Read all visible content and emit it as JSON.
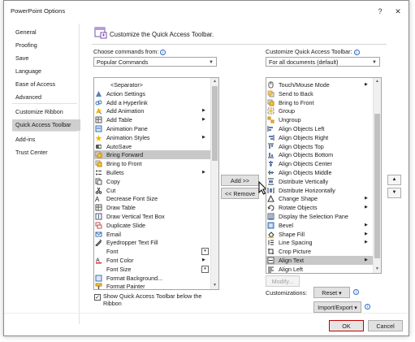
{
  "window": {
    "title": "PowerPoint Options",
    "help_label": "?",
    "close_label": "✕"
  },
  "nav": {
    "items": [
      {
        "label": "General"
      },
      {
        "label": "Proofing"
      },
      {
        "label": "Save"
      },
      {
        "label": "Language"
      },
      {
        "label": "Ease of Access"
      },
      {
        "label": "Advanced"
      },
      {
        "label": "Customize Ribbon"
      },
      {
        "label": "Quick Access Toolbar",
        "selected": true
      },
      {
        "label": "Add-ins"
      },
      {
        "label": "Trust Center"
      }
    ]
  },
  "header": {
    "title": "Customize the Quick Access Toolbar."
  },
  "left": {
    "choose_label": "Choose commands from:",
    "choose_value": "Popular Commands",
    "commands": [
      {
        "label": "<Separator>",
        "icon": "none"
      },
      {
        "label": "Action Settings",
        "icon": "action-settings-icon"
      },
      {
        "label": "Add a Hyperlink",
        "icon": "hyperlink-icon"
      },
      {
        "label": "Add Animation",
        "icon": "animation-icon",
        "submenu": true
      },
      {
        "label": "Add Table",
        "icon": "table-icon",
        "submenu": true
      },
      {
        "label": "Animation Pane",
        "icon": "animation-pane-icon"
      },
      {
        "label": "Animation Styles",
        "icon": "animation-styles-icon",
        "submenu": true
      },
      {
        "label": "AutoSave",
        "icon": "autosave-icon"
      },
      {
        "label": "Bring Forward",
        "icon": "bring-forward-icon",
        "selected": true
      },
      {
        "label": "Bring to Front",
        "icon": "bring-to-front-icon"
      },
      {
        "label": "Bullets",
        "icon": "bullets-icon",
        "submenu": true
      },
      {
        "label": "Copy",
        "icon": "copy-icon"
      },
      {
        "label": "Cut",
        "icon": "cut-icon"
      },
      {
        "label": "Decrease Font Size",
        "icon": "decrease-font-icon"
      },
      {
        "label": "Draw Table",
        "icon": "draw-table-icon"
      },
      {
        "label": "Draw Vertical Text Box",
        "icon": "vertical-textbox-icon"
      },
      {
        "label": "Duplicate Slide",
        "icon": "duplicate-slide-icon"
      },
      {
        "label": "Email",
        "icon": "email-icon"
      },
      {
        "label": "Eyedropper Text Fill",
        "icon": "eyedropper-icon"
      },
      {
        "label": "Font",
        "icon": "none",
        "combo": true
      },
      {
        "label": "Font Color",
        "icon": "font-color-icon",
        "submenu": true
      },
      {
        "label": "Font Size",
        "icon": "none",
        "combo": true
      },
      {
        "label": "Format Background...",
        "icon": "format-background-icon"
      },
      {
        "label": "Format Painter",
        "icon": "format-painter-icon"
      }
    ],
    "show_below_label": "Show Quick Access Toolbar below the Ribbon",
    "show_below_checked": true
  },
  "middle": {
    "add_label": "Add >>",
    "remove_label": "<< Remove"
  },
  "right": {
    "customize_label": "Customize Quick Access Toolbar:",
    "customize_value": "For all documents (default)",
    "commands": [
      {
        "label": "Touch/Mouse Mode",
        "icon": "touch-mouse-icon",
        "submenu": true
      },
      {
        "label": "Send to Back",
        "icon": "send-to-back-icon"
      },
      {
        "label": "Bring to Front",
        "icon": "bring-to-front-icon"
      },
      {
        "label": "Group",
        "icon": "group-icon"
      },
      {
        "label": "Ungroup",
        "icon": "ungroup-icon"
      },
      {
        "label": "Align Objects Left",
        "icon": "align-left-icon"
      },
      {
        "label": "Align Objects Right",
        "icon": "align-right-icon"
      },
      {
        "label": "Align Objects Top",
        "icon": "align-top-icon"
      },
      {
        "label": "Align Objects Bottom",
        "icon": "align-bottom-icon"
      },
      {
        "label": "Align Objects Center",
        "icon": "align-center-icon"
      },
      {
        "label": "Align Objects Middle",
        "icon": "align-middle-icon"
      },
      {
        "label": "Distribute Vertically",
        "icon": "distribute-vertical-icon"
      },
      {
        "label": "Distribute Horizontally",
        "icon": "distribute-horizontal-icon"
      },
      {
        "label": "Change Shape",
        "icon": "change-shape-icon",
        "submenu": true
      },
      {
        "label": "Rotate Objects",
        "icon": "rotate-icon",
        "submenu": true
      },
      {
        "label": "Display the Selection Pane",
        "icon": "selection-pane-icon"
      },
      {
        "label": "Bevel",
        "icon": "bevel-icon",
        "submenu": true
      },
      {
        "label": "Shape Fill",
        "icon": "shape-fill-icon",
        "submenu": true
      },
      {
        "label": "Line Spacing",
        "icon": "line-spacing-icon",
        "submenu": true
      },
      {
        "label": "Crop Picture",
        "icon": "crop-icon"
      },
      {
        "label": "Align Text",
        "icon": "align-text-icon",
        "submenu": true,
        "selected": true
      },
      {
        "label": "Align Left",
        "icon": "align-text-left-icon"
      }
    ],
    "modify_label": "Modify...",
    "customizations_label": "Customizations:",
    "reset_label": "Reset ▾",
    "import_export_label": "Import/Export ▾"
  },
  "footer": {
    "ok_label": "OK",
    "cancel_label": "Cancel"
  },
  "colors": {
    "selection": "#c8c8c8",
    "ok_border": "#c00000",
    "info": "#2a6ac8"
  }
}
